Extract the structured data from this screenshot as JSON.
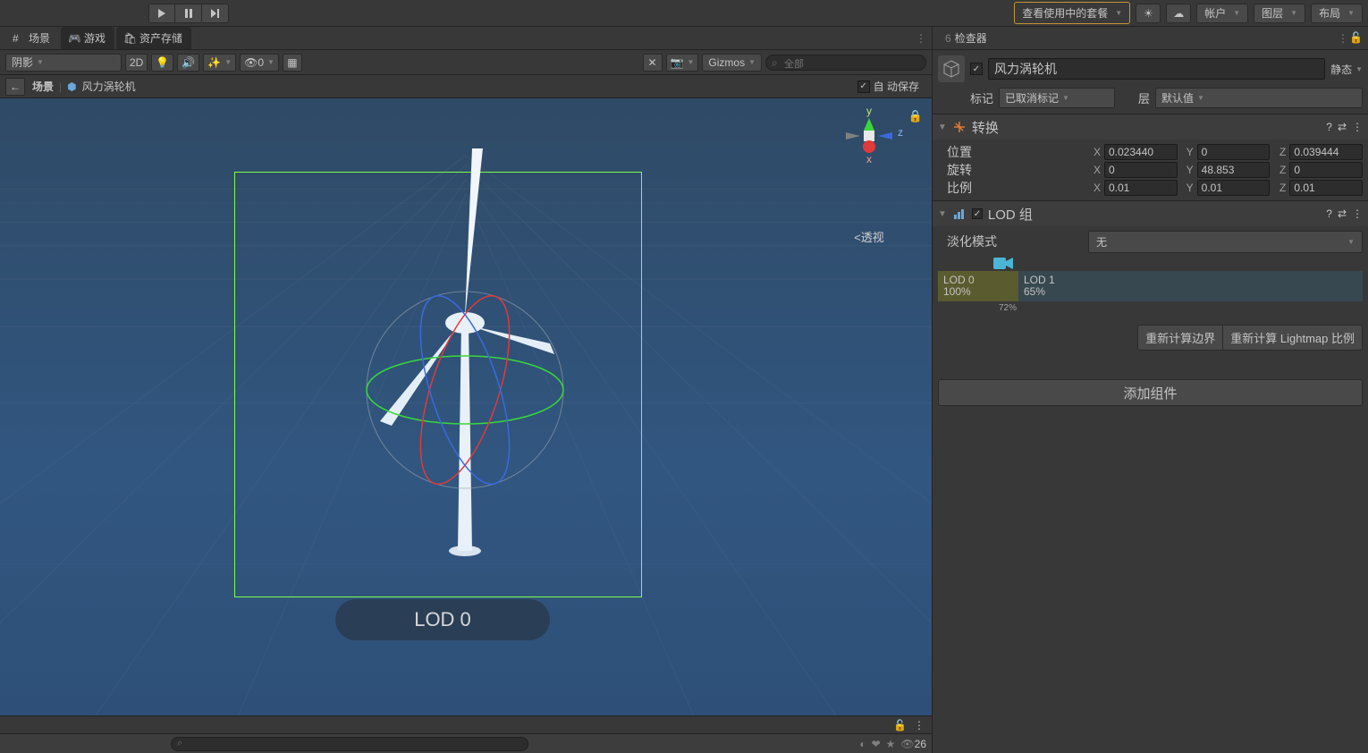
{
  "toolbar": {
    "package_label": "查看使用中的套餐",
    "account_label": "帐户",
    "layers_label": "图层",
    "layout_label": "布局"
  },
  "tabs": {
    "scene": "场景",
    "game": "游戏",
    "asset_store": "资产存储"
  },
  "scene_toolbar": {
    "shading": "阴影",
    "mode_2d": "2D",
    "gizmos": "Gizmos",
    "search_placeholder": "全部",
    "visibility_count": "0"
  },
  "breadcrumbs": {
    "root": "场景",
    "obj": "风力涡轮机"
  },
  "autosave_label": "自 动保存",
  "viewport": {
    "perspective": "<透视",
    "axis_x": "x",
    "axis_y": "y",
    "axis_z": "z",
    "lod_pill": "LOD 0"
  },
  "proj_footer": {
    "hidden": "26"
  },
  "inspector": {
    "tab_label": "检查器",
    "tab_num": "6",
    "obj_name": "风力涡轮机",
    "static_label": "静态",
    "tag_label": "标记",
    "tag_value": "已取消标记",
    "layer_label": "层",
    "layer_value": "默认值",
    "transform": {
      "title": "转换",
      "position": "位置",
      "rotation": "旋转",
      "scale": "比例",
      "pos_x": "0.023440",
      "pos_y": "0",
      "pos_z": "0.039444",
      "rot_x": "0",
      "rot_y": "48.853",
      "rot_z": "0",
      "scl_x": "0.01",
      "scl_y": "0.01",
      "scl_z": "0.01"
    },
    "lodgroup": {
      "title": "LOD 组",
      "fade_label": "淡化模式",
      "fade_value": "无",
      "lod0_name": "LOD 0",
      "lod0_pct": "100%",
      "lod1_name": "LOD 1",
      "lod1_pct": "65%",
      "camera_pct": "72%",
      "recalc_bounds": "重新计算边界",
      "recalc_lm": "重新计算 Lightmap 比例"
    },
    "add_component": "添加组件"
  }
}
